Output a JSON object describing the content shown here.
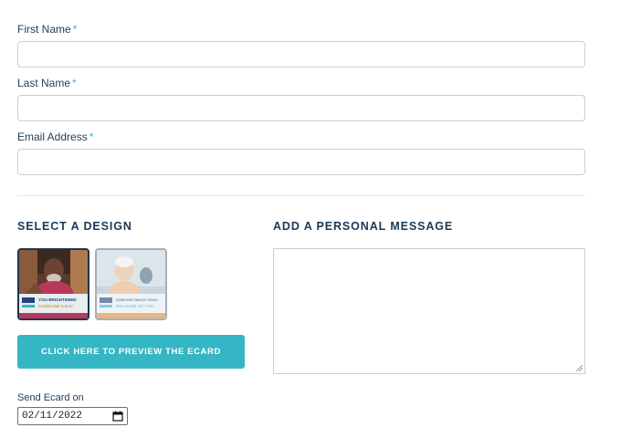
{
  "form": {
    "first_name": {
      "label": "First Name",
      "required": "*",
      "value": ""
    },
    "last_name": {
      "label": "Last Name",
      "required": "*",
      "value": ""
    },
    "email": {
      "label": "Email Address",
      "required": "*",
      "value": ""
    }
  },
  "design_section": {
    "title": "SELECT A DESIGN",
    "designs": [
      {
        "line1": "YOU BRIGHTENED",
        "line2": "SOMEONE'S DAY",
        "selected": true,
        "icon": "ecard-thumbnail-icon"
      },
      {
        "line1": "SOMEONE SMILES TODAY",
        "line2": "BECAUSE OF YOU",
        "selected": false,
        "icon": "ecard-thumbnail-icon"
      }
    ],
    "preview_button": "CLICK HERE TO PREVIEW THE ECARD"
  },
  "message_section": {
    "title": "ADD A PERSONAL MESSAGE",
    "value": ""
  },
  "send": {
    "label": "Send Ecard on",
    "date": "02/11/2022",
    "icon": "calendar-icon"
  },
  "colors": {
    "accent": "#35b6c4",
    "heading": "#1b3a57",
    "border": "#c9cfd5"
  }
}
